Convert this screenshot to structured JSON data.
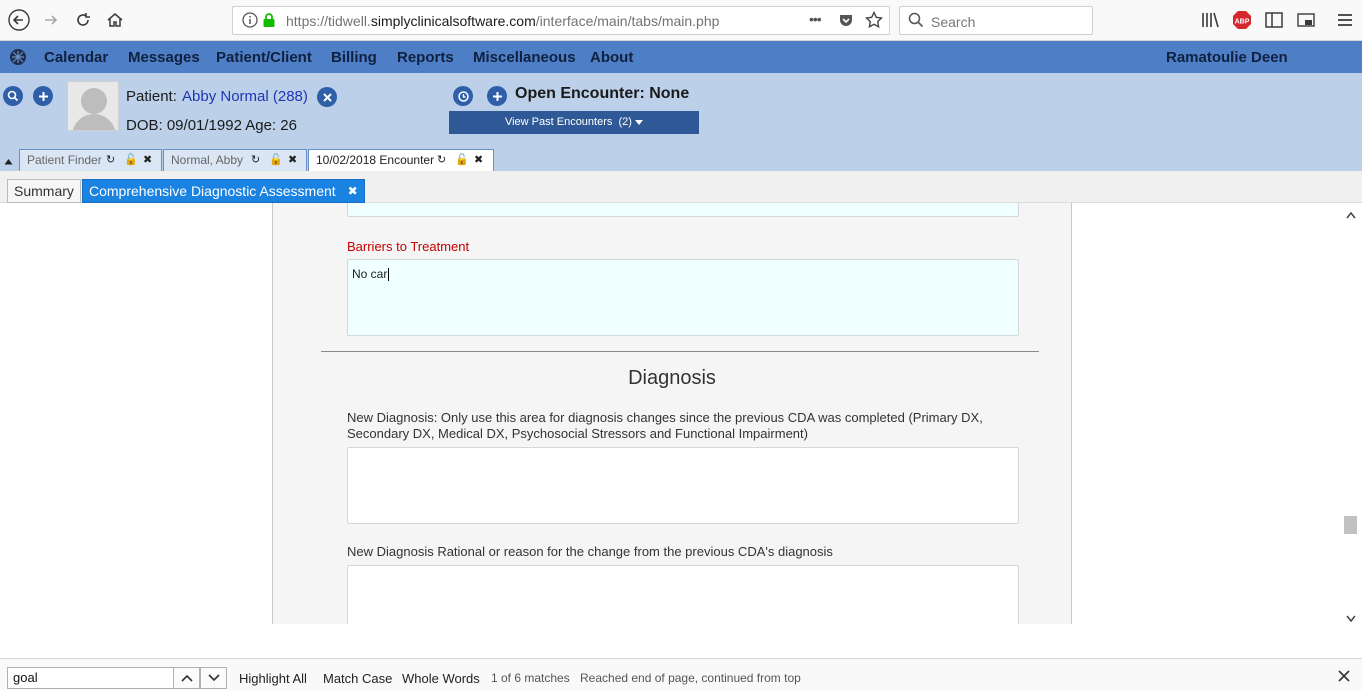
{
  "browser": {
    "url_host": "https://tidwell.",
    "url_domain": "simplyclinicalsoftware.com",
    "url_path": "/interface/main/tabs/main.php",
    "search_placeholder": "Search",
    "more_dots": "•••",
    "abp_label": "ABP"
  },
  "menu": {
    "items": [
      "Calendar",
      "Messages",
      "Patient/Client",
      "Billing",
      "Reports",
      "Miscellaneous",
      "About"
    ],
    "user": "Ramatoulie Deen"
  },
  "patient": {
    "label": "Patient:",
    "name": "Abby Normal (288)",
    "dob_line": "DOB: 09/01/1992 Age: 26",
    "encounter": "Open Encounter: None",
    "past_encounters": "View Past Encounters",
    "past_count": "(2)"
  },
  "patient_tabs": [
    {
      "label": "Patient Finder"
    },
    {
      "label": "Normal, Abby"
    },
    {
      "label": "10/02/2018 Encounter"
    }
  ],
  "sub_tabs": {
    "summary": "Summary",
    "cda": "Comprehensive Diagnostic Assessment"
  },
  "form": {
    "barriers_label": "Barriers to Treatment",
    "barriers_value": "No car",
    "section_title": "Diagnosis",
    "new_dx_label_1": "New Diagnosis: Only use this area for diagnosis changes since the previous CDA was completed (Primary DX,",
    "new_dx_label_2": "Secondary DX, Medical DX, Psychosocial Stressors and Functional Impairment)",
    "new_dx_value": "",
    "rational_label": "New Diagnosis Rational or reason for the change from the previous CDA's diagnosis",
    "rational_value": ""
  },
  "find_bar": {
    "query": "goal",
    "highlight_all": "Highlight All",
    "match_case": "Match Case",
    "whole_words": "Whole Words",
    "match_count": "1 of 6 matches",
    "status": "Reached end of page, continued from top"
  },
  "colors": {
    "menu_bg": "#4e7fc6",
    "header_bg": "#bcd0ea",
    "active_tab": "#1a83e2",
    "barrier_label": "#c40000",
    "text_area_tint": "#f0ffff"
  }
}
